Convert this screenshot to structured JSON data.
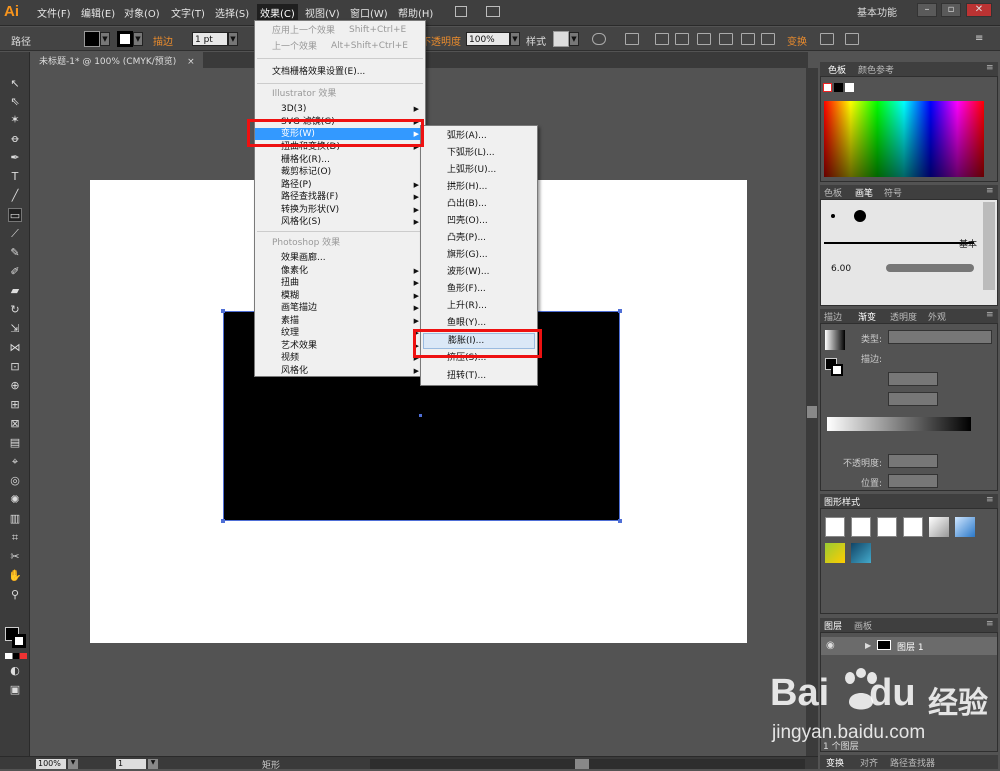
{
  "app": {
    "logo_text": "Ai",
    "workspace": "基本功能"
  },
  "menubar": [
    "文件(F)",
    "编辑(E)",
    "对象(O)",
    "文字(T)",
    "选择(S)",
    "效果(C)",
    "视图(V)",
    "窗口(W)",
    "帮助(H)"
  ],
  "controlbar": {
    "label_path": "路径",
    "stroke_label": "描边",
    "stroke_value": "1 pt",
    "opacity_label": "不透明度",
    "opacity_value": "100%",
    "style_label": "样式",
    "transform_label": "变换"
  },
  "document": {
    "tab_title": "未标题-1* @ 100% (CMYK/预览)",
    "close_glyph": "×"
  },
  "statusbar": {
    "zoom": "100%",
    "page": "1",
    "status_text": "矩形"
  },
  "effect_menu": {
    "items": [
      {
        "label": "应用上一个效果",
        "shortcut": "Shift+Ctrl+E",
        "enabled": false
      },
      {
        "label": "上一个效果",
        "shortcut": "Alt+Shift+Ctrl+E",
        "enabled": false
      },
      {
        "label": "文档栅格效果设置(E)...",
        "shortcut": "",
        "enabled": true
      },
      {
        "label": "Illustrator 效果",
        "header": true
      },
      {
        "label": "3D(3)",
        "submenu": true
      },
      {
        "label": "SVG 滤镜(G)",
        "submenu": true
      },
      {
        "label": "变形(W)",
        "submenu": true,
        "highlighted": true
      },
      {
        "label": "扭曲和变换(D)",
        "submenu": true
      },
      {
        "label": "栅格化(R)..."
      },
      {
        "label": "裁剪标记(O)"
      },
      {
        "label": "路径(P)",
        "submenu": true
      },
      {
        "label": "路径查找器(F)",
        "submenu": true
      },
      {
        "label": "转换为形状(V)",
        "submenu": true
      },
      {
        "label": "风格化(S)",
        "submenu": true
      },
      {
        "label": "Photoshop 效果",
        "header": true
      },
      {
        "label": "效果画廊..."
      },
      {
        "label": "像素化",
        "submenu": true
      },
      {
        "label": "扭曲",
        "submenu": true
      },
      {
        "label": "模糊",
        "submenu": true
      },
      {
        "label": "画笔描边",
        "submenu": true
      },
      {
        "label": "素描",
        "submenu": true
      },
      {
        "label": "纹理",
        "submenu": true
      },
      {
        "label": "艺术效果",
        "submenu": true
      },
      {
        "label": "视频",
        "submenu": true
      },
      {
        "label": "风格化",
        "submenu": true
      }
    ]
  },
  "warp_submenu": {
    "items": [
      "弧形(A)...",
      "下弧形(L)...",
      "上弧形(U)...",
      "拱形(H)...",
      "凸出(B)...",
      "凹壳(O)...",
      "凸壳(P)...",
      "旗形(G)...",
      "波形(W)...",
      "鱼形(F)...",
      "上升(R)...",
      "鱼眼(Y)...",
      "膨胀(I)...",
      "挤压(S)...",
      "扭转(T)..."
    ],
    "hover_index": 12
  },
  "panels": {
    "swatches_tabs": [
      "色板",
      "颜色参考"
    ],
    "brushes_tabs": [
      "色板",
      "画笔",
      "符号"
    ],
    "brush_basic": "基本",
    "brush_size": "6.00",
    "gradient_tabs": [
      "描边",
      "渐变",
      "透明度",
      "外观"
    ],
    "gradient_type_label": "类型:",
    "gradient_stroke_label": "描边:",
    "gradient_opacity_label": "不透明度:",
    "gradient_position_label": "位置:",
    "graphic_styles_title": "图形样式",
    "layers_tabs": [
      "图层",
      "画板"
    ],
    "layer_name": "图层 1",
    "layer_count": "1 个图层",
    "bottom_tabs": [
      "变换",
      "对齐",
      "路径查找器"
    ]
  },
  "watermark": {
    "brand": "Bai",
    "brand2": "du",
    "cn": "经验",
    "url": "jingyan.baidu.com"
  },
  "colors": {
    "highlight": "#3399ff",
    "red_box": "#ee1111",
    "ai_orange": "#f7941d"
  }
}
